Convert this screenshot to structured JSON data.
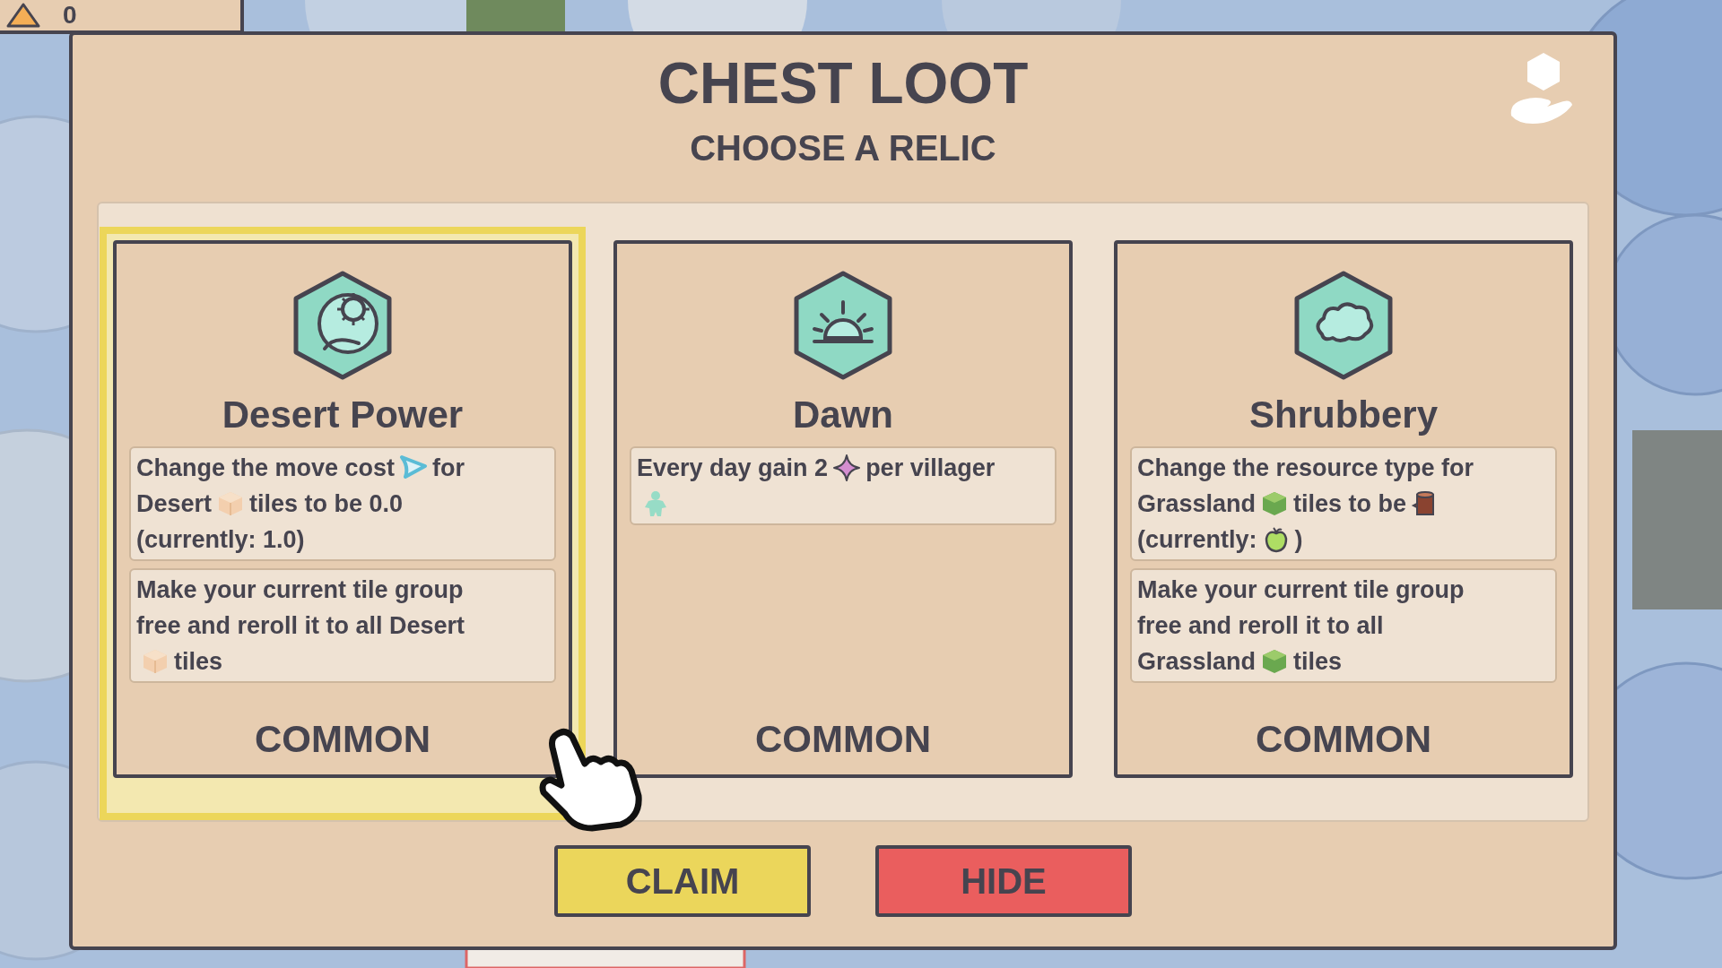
{
  "hud": {
    "value": "0"
  },
  "dialog": {
    "title": "CHEST LOOT",
    "subtitle": "CHOOSE A RELIC"
  },
  "cards": [
    {
      "name": "Desert Power",
      "kind": "sun-moon",
      "selected": true,
      "rarity": "COMMON",
      "effects": [
        [
          [
            {
              "kind": "text",
              "text": "Change the move cost"
            },
            {
              "kind": "arrow"
            },
            {
              "kind": "text",
              "text": "for"
            }
          ],
          [
            {
              "kind": "text",
              "text": "Desert"
            },
            {
              "kind": "sand"
            },
            {
              "kind": "text",
              "text": "tiles to be 0.0"
            }
          ],
          [
            {
              "kind": "text",
              "text": "(currently: 1.0)"
            }
          ]
        ],
        [
          [
            {
              "kind": "text",
              "text": "Make your current tile group"
            }
          ],
          [
            {
              "kind": "text",
              "text": "free and reroll it to all Desert"
            }
          ],
          [
            {
              "kind": "sand"
            },
            {
              "kind": "text",
              "text": "tiles"
            }
          ]
        ]
      ]
    },
    {
      "name": "Dawn",
      "kind": "sunrise",
      "selected": false,
      "rarity": "COMMON",
      "effects": [
        [
          [
            {
              "kind": "text",
              "text": "Every day gain 2"
            },
            {
              "kind": "star"
            },
            {
              "kind": "text",
              "text": "per villager"
            }
          ],
          [
            {
              "kind": "villager"
            }
          ]
        ]
      ]
    },
    {
      "name": "Shrubbery",
      "kind": "cloud",
      "selected": false,
      "rarity": "COMMON",
      "effects": [
        [
          [
            {
              "kind": "text",
              "text": "Change the resource type for"
            }
          ],
          [
            {
              "kind": "text",
              "text": "Grassland"
            },
            {
              "kind": "grass"
            },
            {
              "kind": "text",
              "text": "tiles to be"
            },
            {
              "kind": "log"
            }
          ],
          [
            {
              "kind": "text",
              "text": "(currently:"
            },
            {
              "kind": "apple"
            },
            {
              "kind": "text",
              "text": ")"
            }
          ]
        ],
        [
          [
            {
              "kind": "text",
              "text": "Make your current tile group"
            }
          ],
          [
            {
              "kind": "text",
              "text": "free and reroll it to all"
            }
          ],
          [
            {
              "kind": "text",
              "text": "Grassland"
            },
            {
              "kind": "grass"
            },
            {
              "kind": "text",
              "text": "tiles"
            }
          ]
        ]
      ]
    }
  ],
  "buttons": [
    {
      "label": "CLAIM",
      "kind": "confirm"
    },
    {
      "label": "HIDE",
      "kind": "cancel"
    }
  ]
}
